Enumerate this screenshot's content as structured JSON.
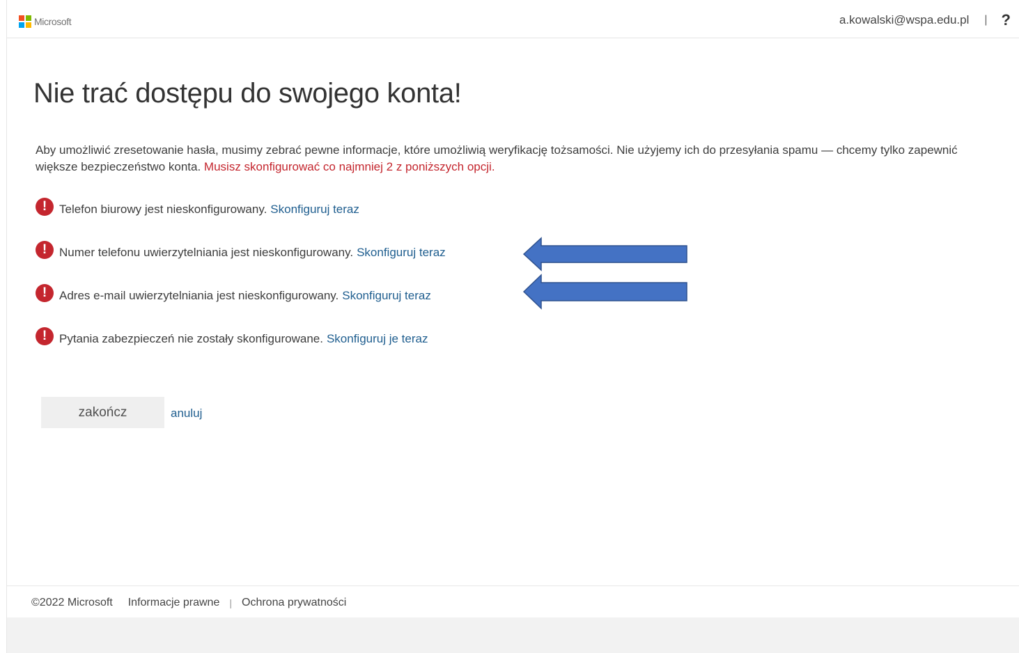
{
  "header": {
    "brand": "Microsoft",
    "logo_colors": [
      "#f25022",
      "#7fba00",
      "#00a4ef",
      "#ffb900"
    ],
    "user_email": "a.kowalski@wspa.edu.pl",
    "separator": "|",
    "help_label": "?"
  },
  "main": {
    "title": "Nie trać dostępu do swojego konta!",
    "intro_text": "Aby umożliwić zresetowanie hasła, musimy zebrać pewne informacje, które umożliwią weryfikację tożsamości. Nie użyjemy ich do przesyłania spamu — chcemy tylko zapewnić większe bezpieczeństwo konta.",
    "intro_warning": "Musisz skonfigurować co najmniej 2 z poniższych opcji.",
    "items": [
      {
        "text": "Telefon biurowy jest nieskonfigurowany.",
        "link": "Skonfiguruj teraz"
      },
      {
        "text": "Numer telefonu uwierzytelniania jest nieskonfigurowany.",
        "link": "Skonfiguruj teraz"
      },
      {
        "text": "Adres e-mail uwierzytelniania jest nieskonfigurowany.",
        "link": "Skonfiguruj teraz"
      },
      {
        "text": "Pytania zabezpieczeń nie zostały skonfigurowane.",
        "link": "Skonfiguruj je teraz"
      }
    ],
    "alert_glyph": "!",
    "finish_button": "zakończ",
    "cancel_link": "anuluj"
  },
  "annotations": {
    "arrow_color": "#4472c4",
    "arrow_border_color": "#2f528f"
  },
  "footer": {
    "copyright": "©2022 Microsoft",
    "legal_link": "Informacje prawne",
    "separator": "|",
    "privacy_link": "Ochrona prywatności"
  },
  "colors": {
    "warning": "#c4262e",
    "link": "#1f5e8f"
  }
}
